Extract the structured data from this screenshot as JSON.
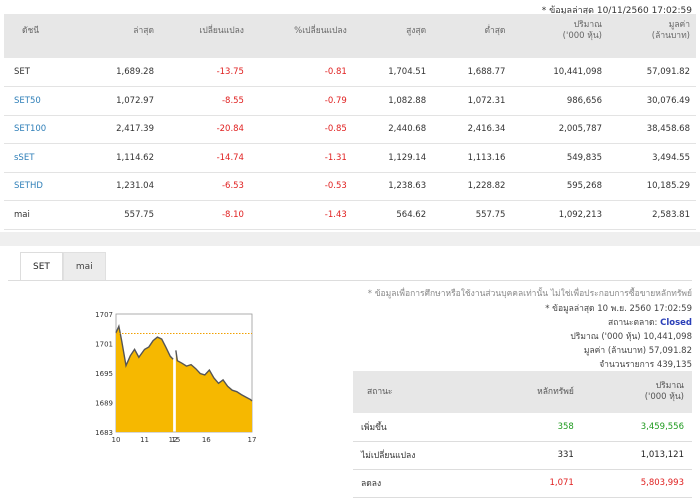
{
  "as_of": "* ข้อมูลล่าสุด 10/11/2560 17:02:59",
  "table": {
    "headers": [
      "ดัชนี",
      "ล่าสุด",
      "เปลี่ยนแปลง",
      "%เปลี่ยนแปลง",
      "สูงสุด",
      "ต่ำสุด",
      "ปริมาณ\n('000 หุ้น)",
      "มูลค่า\n(ล้านบาท)"
    ],
    "rows": [
      {
        "name": "SET",
        "last": "1,689.28",
        "chg": "-13.75",
        "pct": "-0.81",
        "high": "1,704.51",
        "low": "1,688.77",
        "vol": "10,441,098",
        "val": "57,091.82"
      },
      {
        "name": "SET50",
        "last": "1,072.97",
        "chg": "-8.55",
        "pct": "-0.79",
        "high": "1,082.88",
        "low": "1,072.31",
        "vol": "986,656",
        "val": "30,076.49"
      },
      {
        "name": "SET100",
        "last": "2,417.39",
        "chg": "-20.84",
        "pct": "-0.85",
        "high": "2,440.68",
        "low": "2,416.34",
        "vol": "2,005,787",
        "val": "38,458.68"
      },
      {
        "name": "sSET",
        "last": "1,114.62",
        "chg": "-14.74",
        "pct": "-1.31",
        "high": "1,129.14",
        "low": "1,113.16",
        "vol": "549,835",
        "val": "3,494.55"
      },
      {
        "name": "SETHD",
        "last": "1,231.04",
        "chg": "-6.53",
        "pct": "-0.53",
        "high": "1,238.63",
        "low": "1,228.82",
        "vol": "595,268",
        "val": "10,185.29"
      },
      {
        "name": "mai",
        "last": "557.75",
        "chg": "-8.10",
        "pct": "-1.43",
        "high": "564.62",
        "low": "557.75",
        "vol": "1,092,213",
        "val": "2,583.81"
      }
    ]
  },
  "tabs": [
    "SET",
    "mai"
  ],
  "info": {
    "disclaimer": "* ข้อมูลเพื่อการศึกษาหรือใช้งานส่วนบุคคลเท่านั้น ไม่ใช่เพื่อประกอบการซื้อขายหลักทรัพย์",
    "as_of": "* ข้อมูลล่าสุด 10 พ.ย. 2560 17:02:59",
    "status_label": "สถานะตลาด:",
    "status_value": "Closed",
    "volume": "ปริมาณ ('000 หุ้น) 10,441,098",
    "value": "มูลค่า (ล้านบาท) 57,091.82",
    "trades": "จำนวนรายการ 439,135"
  },
  "status_table": {
    "headers": [
      "สถานะ",
      "หลักทรัพย์",
      "ปริมาณ\n('000 หุ้น)"
    ],
    "rows": [
      {
        "label": "เพิ่มขึ้น",
        "count": "358",
        "volume": "3,459,556",
        "color": "pos"
      },
      {
        "label": "ไม่เปลี่ยนแปลง",
        "count": "331",
        "volume": "1,013,121",
        "color": "none"
      },
      {
        "label": "ลดลง",
        "count": "1,071",
        "volume": "5,803,993",
        "color": "neg"
      }
    ]
  },
  "chart_data": {
    "type": "area",
    "y_ticks": [
      "1707",
      "1701",
      "1695",
      "1689",
      "1683"
    ],
    "x_ticks": [
      "10",
      "11",
      "12",
      "15",
      "16",
      "17"
    ],
    "ylim": [
      1683,
      1707
    ],
    "prev_close": 1703.03,
    "fill": "#f6b800",
    "line": "#555555",
    "x": [
      10.0,
      10.1,
      10.2,
      10.35,
      10.5,
      10.65,
      10.8,
      11.0,
      11.15,
      11.3,
      11.45,
      11.6,
      11.75,
      11.9,
      12.0,
      14.5,
      14.55,
      14.7,
      14.85,
      15.0,
      15.15,
      15.3,
      15.45,
      15.6,
      15.75,
      15.9,
      16.05,
      16.2,
      16.35,
      16.5,
      16.65,
      16.8,
      16.95,
      17.0
    ],
    "y": [
      1703.2,
      1704.5,
      1701.5,
      1696.5,
      1698.5,
      1699.8,
      1698.2,
      1699.8,
      1700.3,
      1701.6,
      1702.3,
      1701.9,
      1700.2,
      1698.4,
      1697.8,
      1699.6,
      1697.5,
      1697.0,
      1696.4,
      1696.7,
      1695.9,
      1694.9,
      1694.6,
      1695.6,
      1694.0,
      1692.9,
      1693.6,
      1692.3,
      1691.5,
      1691.2,
      1690.6,
      1690.1,
      1689.6,
      1689.3
    ]
  }
}
